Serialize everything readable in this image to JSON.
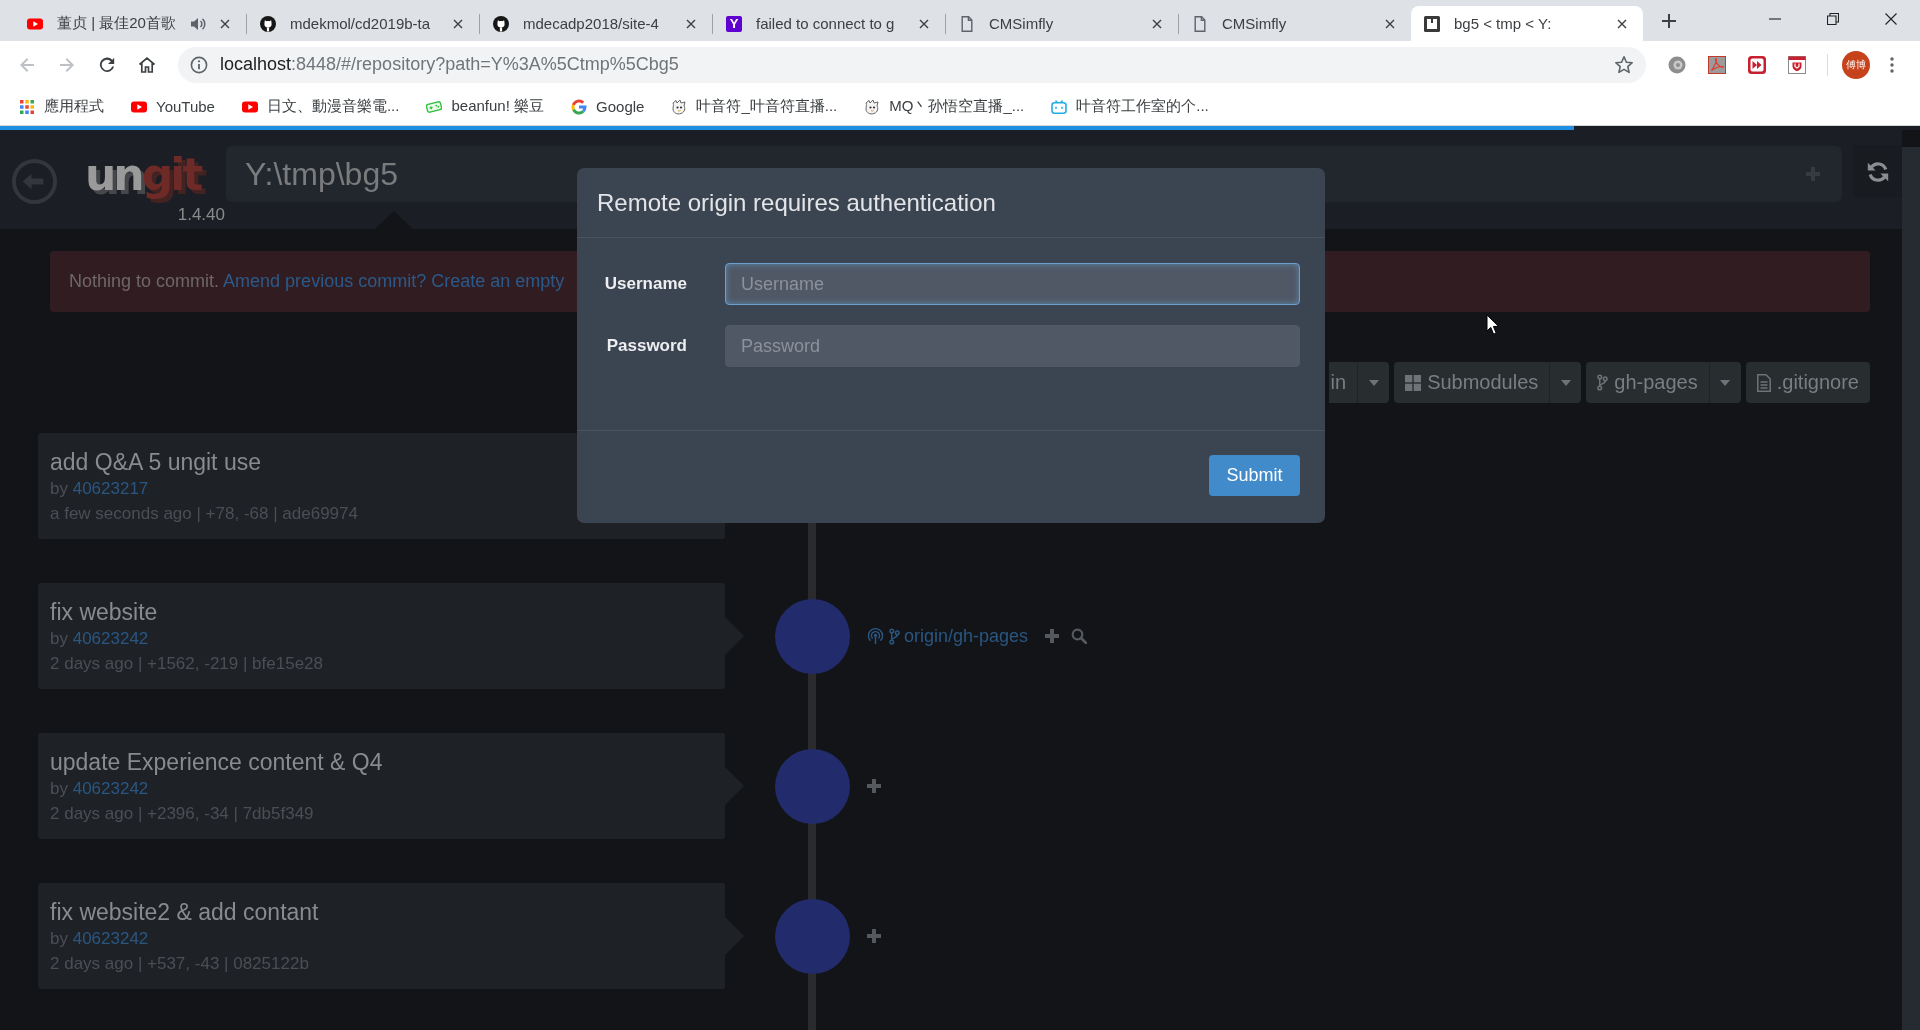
{
  "browser": {
    "tabs": [
      {
        "title": "董贞 | 最佳20首歌",
        "kind": "youtube",
        "audio": true,
        "selected": false
      },
      {
        "title": "mdekmol/cd2019b-ta",
        "kind": "github",
        "audio": false,
        "selected": false
      },
      {
        "title": "mdecadp2018/site-4",
        "kind": "github",
        "audio": false,
        "selected": false
      },
      {
        "title": "failed to connect to g",
        "kind": "letter",
        "letter": "Y",
        "audio": false,
        "selected": false
      },
      {
        "title": "CMSimfly",
        "kind": "page",
        "audio": false,
        "selected": false
      },
      {
        "title": "CMSimfly",
        "kind": "page",
        "audio": false,
        "selected": false
      },
      {
        "title": "bg5 < tmp < Y:",
        "kind": "ungit",
        "audio": false,
        "selected": true
      }
    ],
    "navigation": {
      "back_disabled": true,
      "forward_disabled": true
    },
    "url": {
      "host": "localhost",
      "rest": ":8448/#/repository?path=Y%3A%5Ctmp%5Cbg5"
    },
    "bookmarks": [
      {
        "label": "應用程式",
        "kind": "apps"
      },
      {
        "label": "YouTube",
        "kind": "youtube"
      },
      {
        "label": "日文、動漫音樂電...",
        "kind": "youtube"
      },
      {
        "label": "beanfun! 樂豆",
        "kind": "gamepad"
      },
      {
        "label": "Google",
        "kind": "google"
      },
      {
        "label": "叶音符_叶音符直播...",
        "kind": "mascot"
      },
      {
        "label": "MQ丶孙悟空直播_...",
        "kind": "mascot"
      },
      {
        "label": "叶音符工作室的个...",
        "kind": "tv"
      }
    ],
    "profile": {
      "initials": "傅博"
    }
  },
  "progress": {
    "level": 0.82
  },
  "header": {
    "logo": {
      "left": "un",
      "right": "git"
    },
    "version": "1.4.40",
    "path": "Y:\\tmp\\bg5"
  },
  "banner": {
    "text": "Nothing to commit.",
    "link": "Amend previous commit? Create an empty"
  },
  "toolbar": [
    {
      "label": "in",
      "kind": "text",
      "clipped": true,
      "dropdown": true
    },
    {
      "label": "Submodules",
      "kind": "grid",
      "clipped": false,
      "dropdown": true
    },
    {
      "label": "gh-pages",
      "kind": "branch",
      "clipped": false,
      "dropdown": true
    },
    {
      "label": ".gitignore",
      "kind": "file",
      "clipped": false,
      "dropdown": false
    }
  ],
  "commits": [
    {
      "title": "add Q&A 5 ungit use",
      "by": "by",
      "author": "40623217",
      "meta": "a few seconds ago | +78, -68 | ade69974",
      "graph_node": false
    },
    {
      "title": "fix website",
      "by": "by",
      "author": "40623242",
      "meta": "2 days ago | +1562, -219 | bfe15e28",
      "graph_node": true,
      "refs": [
        {
          "label": "origin/gh-pages",
          "kind": "remote"
        }
      ]
    },
    {
      "title": "update Experience content & Q4",
      "by": "by",
      "author": "40623242",
      "meta": "2 days ago | +2396, -34 | 7db5f349",
      "graph_node": true
    },
    {
      "title": "fix website2 & add contant",
      "by": "by",
      "author": "40623242",
      "meta": "2 days ago | +537, -43 | 0825122b",
      "graph_node": true
    }
  ],
  "dialog": {
    "title": "Remote origin requires authentication",
    "fields": [
      {
        "label": "Username",
        "placeholder": "Username",
        "focused": true
      },
      {
        "label": "Password",
        "placeholder": "Password",
        "focused": false
      }
    ],
    "submit": "Submit"
  }
}
